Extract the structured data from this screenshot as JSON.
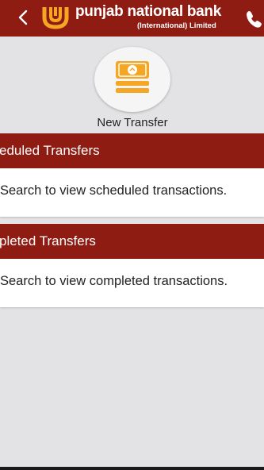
{
  "header": {
    "bank_name": "punjab national bank",
    "subtitle": "(International) Limited",
    "brand_color": "#8e1c13",
    "logo_color": "#f5a623",
    "icons": [
      "back-arrow-icon",
      "pnb-logo-icon",
      "phone-icon"
    ]
  },
  "new_transfer": {
    "label": "New Transfer",
    "icon": "money-transfer-icon",
    "icon_color": "#f5a623"
  },
  "scheduled": {
    "title": "eduled Transfers",
    "message": "Search to view scheduled transactions."
  },
  "completed": {
    "title": "pleted Transfers",
    "message": "Search to view completed transactions."
  }
}
